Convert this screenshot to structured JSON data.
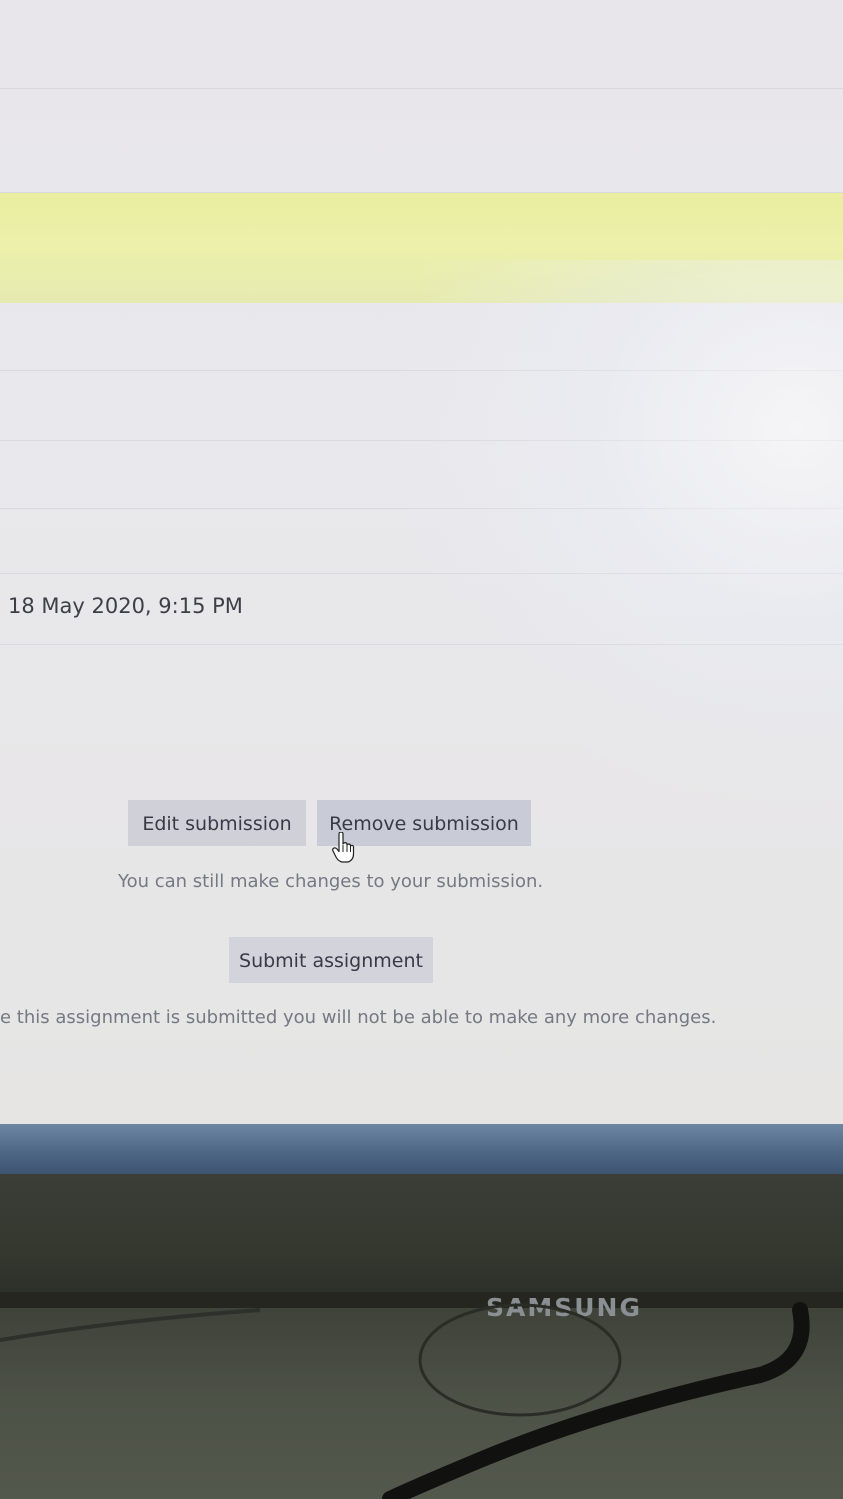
{
  "submission": {
    "due_date_value": "18 May 2020, 9:15 PM",
    "edit_button_label": "Edit submission",
    "remove_button_label": "Remove submission",
    "changes_help_text": "You can still make changes to your submission.",
    "submit_button_label": "Submit assignment",
    "submit_warning_text": "e this assignment is submitted you will not be able to make any more changes."
  },
  "monitor": {
    "brand": "SAMSUNG"
  },
  "icons": {
    "cursor": "hand-pointer-icon"
  },
  "colors": {
    "highlight_band": "#ecf0ab",
    "button_bg": "#cfd0d8",
    "taskbar": "#4e6886"
  }
}
